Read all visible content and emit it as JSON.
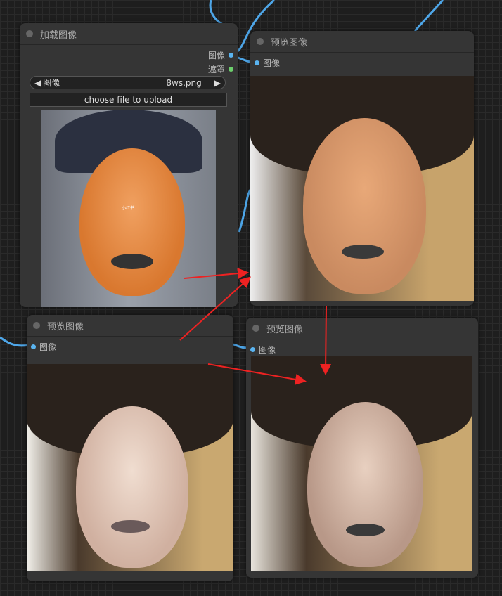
{
  "load_node": {
    "title": "加载图像",
    "outputs": [
      "图像",
      "遮罩"
    ],
    "combo_label": "图像",
    "combo_value": "8ws.png",
    "upload_button": "choose file to upload",
    "image_watermark": "小红书"
  },
  "preview_nodes": [
    {
      "title": "预览图像",
      "input": "图像"
    },
    {
      "title": "预览图像",
      "input": "图像"
    },
    {
      "title": "预览图像",
      "input": "图像"
    }
  ],
  "colors": {
    "image_slot": "#5ab4f0",
    "mask_slot": "#6ccf6c",
    "wire": "#4ea6e8",
    "arrow": "#ee2222"
  }
}
